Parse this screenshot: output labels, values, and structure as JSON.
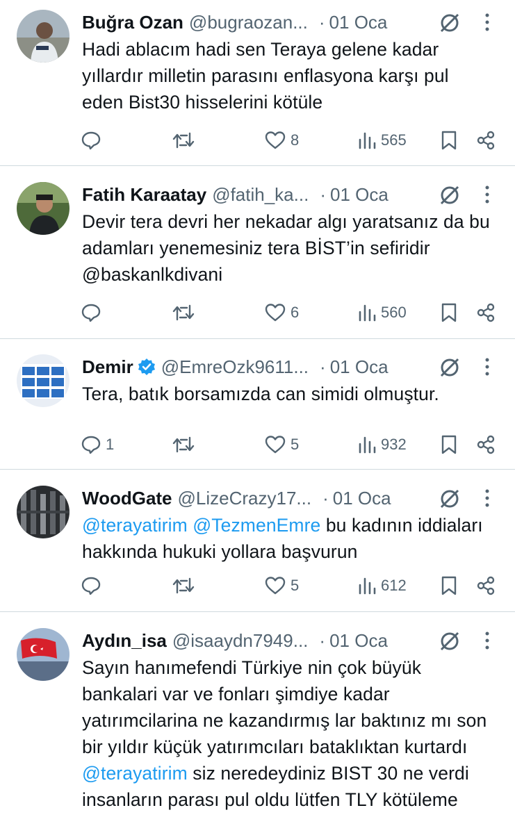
{
  "tweets": [
    {
      "name": "Buğra Ozan",
      "handle": "@bugraozan...",
      "dot": "·",
      "date": "01 Oca",
      "verified": false,
      "text_parts": [
        {
          "t": "Hadi ablacım hadi sen Teraya gelene kadar yıllardır milletin parasını enflasyona karşı pul eden Bist30 hisselerini kötüle",
          "mention": false
        }
      ],
      "replies": "",
      "retweets": "",
      "likes": "8",
      "views": "565",
      "avatar": "person-avatar"
    },
    {
      "name": "Fatih Karaatay",
      "handle": "@fatih_ka...",
      "dot": "·",
      "date": "01 Oca",
      "verified": false,
      "text_parts": [
        {
          "t": "Devir tera devri her nekadar  algı yaratsanız da bu adamları yenemesiniz tera BİST’in sefiridir @baskanlkdivani",
          "mention": false
        }
      ],
      "replies": "",
      "retweets": "",
      "likes": "6",
      "views": "560",
      "avatar": "person-avatar"
    },
    {
      "name": "Demir",
      "handle": "@EmreOzk9611...",
      "dot": "·",
      "date": "01 Oca",
      "verified": true,
      "text_parts": [
        {
          "t": "Tera, batık borsamızda can simidi olmuştur.",
          "mention": false
        }
      ],
      "replies": "1",
      "retweets": "",
      "likes": "5",
      "views": "932",
      "avatar": "calendar-avatar"
    },
    {
      "name": "WoodGate",
      "handle": "@LizeCrazy17...",
      "dot": "·",
      "date": "01 Oca",
      "verified": false,
      "text_parts": [
        {
          "t": "@terayatirim",
          "mention": true
        },
        {
          "t": " ",
          "mention": false
        },
        {
          "t": "@TezmenEmre",
          "mention": true
        },
        {
          "t": " bu kadının iddiaları hakkında hukuki yollara başvurun",
          "mention": false
        }
      ],
      "replies": "",
      "retweets": "",
      "likes": "5",
      "views": "612",
      "avatar": "machinery-avatar"
    },
    {
      "name": "Aydın_isa",
      "handle": "@isaaydn7949...",
      "dot": "·",
      "date": "01 Oca",
      "verified": false,
      "text_parts": [
        {
          "t": "Sayın hanımefendi Türkiye nin çok büyük bankalari var ve fonları şimdiye kadar yatırımcilarina ne kazandırmış lar baktınız mı son bir yıldır küçük yatırımcıları bataklıktan kurtardı ",
          "mention": false
        },
        {
          "t": "@terayatirim",
          "mention": true
        },
        {
          "t": " siz neredeydiniz BIST 30 ne verdi insanların parası pul oldu lütfen TLY kötüleme",
          "mention": false
        }
      ],
      "replies": "",
      "retweets": "",
      "likes": "",
      "views": "",
      "avatar": "flag-avatar"
    }
  ],
  "colors": {
    "mention": "#1d9bf0",
    "secondary": "#536471",
    "divider": "#cfd9de",
    "verified": "#1d9bf0"
  }
}
